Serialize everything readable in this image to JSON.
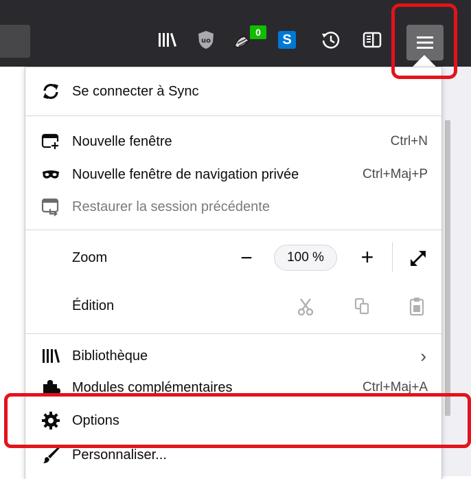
{
  "toolbar": {
    "icons": [
      "library-icon",
      "ublock-icon",
      "extension-icon",
      "skype-icon",
      "history-icon",
      "sidebar-icon"
    ],
    "extension_badge": "0",
    "skype_letter": "S",
    "menu_button": "hamburger-menu-icon"
  },
  "menu": {
    "sync": "Se connecter à Sync",
    "new_window": "Nouvelle fenêtre",
    "new_window_shortcut": "Ctrl+N",
    "private_window": "Nouvelle fenêtre de navigation privée",
    "private_window_shortcut": "Ctrl+Maj+P",
    "restore_session": "Restaurer la session précédente",
    "zoom_label": "Zoom",
    "zoom_minus": "−",
    "zoom_value": "100 %",
    "zoom_plus": "+",
    "edit_label": "Édition",
    "library": "Bibliothèque",
    "library_arrow": "›",
    "addons": "Modules complémentaires",
    "addons_shortcut": "Ctrl+Maj+A",
    "options": "Options",
    "customize": "Personnaliser..."
  },
  "colors": {
    "toolbar": "#2a2a2e",
    "highlight": "#e3131b",
    "badge": "#12bc00",
    "skype": "#0078d4"
  }
}
